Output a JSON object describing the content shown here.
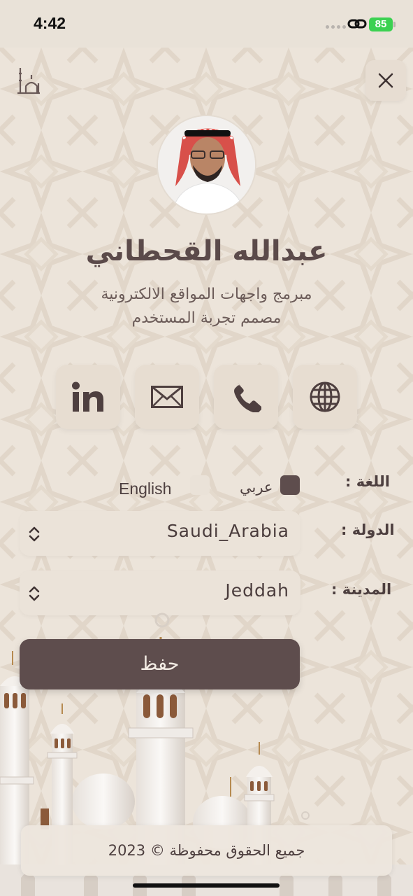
{
  "status_bar": {
    "time": "4:42",
    "battery": "85"
  },
  "profile": {
    "name": "عبدالله القحطاني",
    "subtitle_line1": "مبرمج واجهات المواقع الالكترونية",
    "subtitle_line2": "مصمم تجربة المستخدم"
  },
  "social": [
    {
      "icon": "linkedin-icon"
    },
    {
      "icon": "mail-icon"
    },
    {
      "icon": "phone-icon"
    },
    {
      "icon": "globe-icon"
    }
  ],
  "language": {
    "label": "اللغة :",
    "options": [
      "عربي",
      "English"
    ],
    "selected": "عربي"
  },
  "country": {
    "label": "الدولة :",
    "value": "Saudi_Arabia"
  },
  "city": {
    "label": "المدينة :",
    "value": "Jeddah"
  },
  "save_label": "حفظ",
  "footer": "جميع الحقوق محفوظة © 2023",
  "colors": {
    "accent": "#5e4d4d",
    "background": "#ece4da",
    "battery": "#3bd151"
  }
}
